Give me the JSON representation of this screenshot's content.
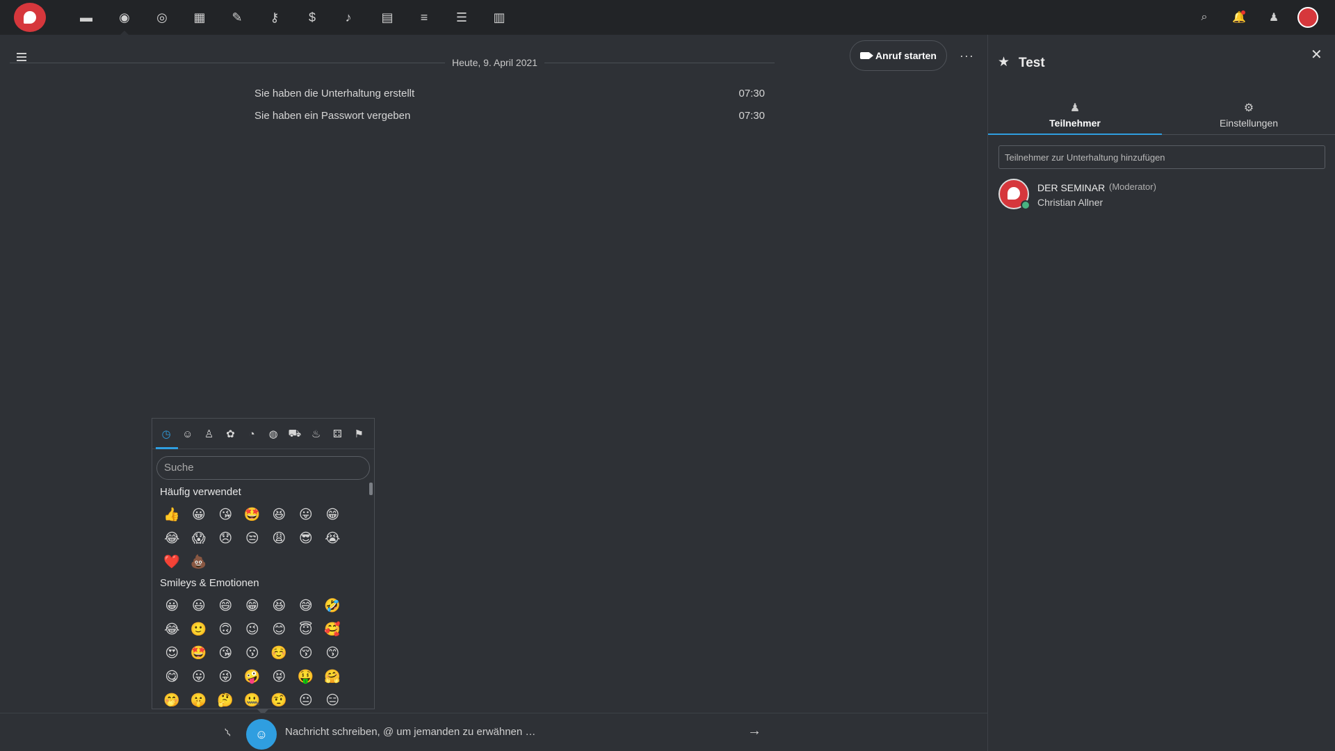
{
  "topbar": {
    "apps": [
      {
        "icon": "files-icon",
        "glyph": "▬"
      },
      {
        "icon": "talk-icon",
        "glyph": "◉"
      },
      {
        "icon": "activity-icon",
        "glyph": "◎"
      },
      {
        "icon": "deck-icon",
        "glyph": "▦"
      },
      {
        "icon": "notes-pencil-icon",
        "glyph": "✎"
      },
      {
        "icon": "passwords-key-icon",
        "glyph": "⚷"
      },
      {
        "icon": "money-bag-icon",
        "glyph": "$"
      },
      {
        "icon": "microphone-icon",
        "glyph": "♪"
      },
      {
        "icon": "calendar-icon",
        "glyph": "▤"
      },
      {
        "icon": "text-align-icon",
        "glyph": "≡"
      },
      {
        "icon": "list-icon",
        "glyph": "☰"
      },
      {
        "icon": "chart-icon",
        "glyph": "▥"
      }
    ],
    "right_icons": [
      {
        "icon": "search-icon",
        "glyph": "⌕"
      },
      {
        "icon": "notification-bell-icon",
        "glyph": "♟"
      },
      {
        "icon": "contacts-icon",
        "glyph": "👤"
      }
    ]
  },
  "chat": {
    "date_label": "Heute, 9. April 2021",
    "call_button": "Anruf starten",
    "more_menu": "···",
    "messages": [
      {
        "text": "Sie haben die Unterhaltung erstellt",
        "time": "07:30"
      },
      {
        "text": "Sie haben ein Passwort vergeben",
        "time": "07:30"
      }
    ],
    "composer_placeholder": "Nachricht schreiben, @ um jemanden zu erwähnen …"
  },
  "emoji_picker": {
    "categories": [
      "clock-icon",
      "smiley-icon",
      "person-icon",
      "animal-icon",
      "food-icon",
      "sports-icon",
      "car-icon",
      "lightbulb-icon",
      "symbols-icon",
      "flag-icon"
    ],
    "category_glyphs": [
      "◷",
      "☺",
      "♙",
      "✿",
      "◔",
      "◍",
      "⛟",
      "♨",
      "⚃",
      "⚑"
    ],
    "search_placeholder": "Suche",
    "frequently_used_title": "Häufig verwendet",
    "frequently_used": [
      "👍",
      "😀",
      "😘",
      "🤩",
      "😆",
      "😛",
      "😁",
      "😂",
      "😱",
      "😞",
      "😒",
      "😩",
      "😎",
      "😭",
      "❤️",
      "💩"
    ],
    "smileys_title": "Smileys & Emotionen",
    "smileys": [
      "😀",
      "😃",
      "😄",
      "😁",
      "😆",
      "😅",
      "🤣",
      "😂",
      "🙂",
      "🙃",
      "😉",
      "😊",
      "😇",
      "🥰",
      "😍",
      "🤩",
      "😘",
      "😗",
      "☺️",
      "😚",
      "😙",
      "😋",
      "😛",
      "😜",
      "🤪",
      "😝",
      "🤑",
      "🤗",
      "🤭",
      "🤫",
      "🤔",
      "🤐",
      "🤨",
      "😐",
      "😑"
    ]
  },
  "sidebar": {
    "title": "Test",
    "tabs": [
      {
        "label": "Teilnehmer",
        "icon": "participants-icon",
        "glyph": "♟"
      },
      {
        "label": "Einstellungen",
        "icon": "settings-gear-icon",
        "glyph": "⚙"
      }
    ],
    "add_placeholder": "Teilnehmer zur Unterhaltung hinzufügen",
    "participants": [
      {
        "name": "DER SEMINAR",
        "role": "(Moderator)",
        "subtitle": "Christian Allner"
      }
    ]
  },
  "colors": {
    "accent": "#2f9ee0",
    "brand": "#d6373c",
    "online": "#49b382",
    "background": "#2e3136",
    "topbar": "#222427"
  }
}
